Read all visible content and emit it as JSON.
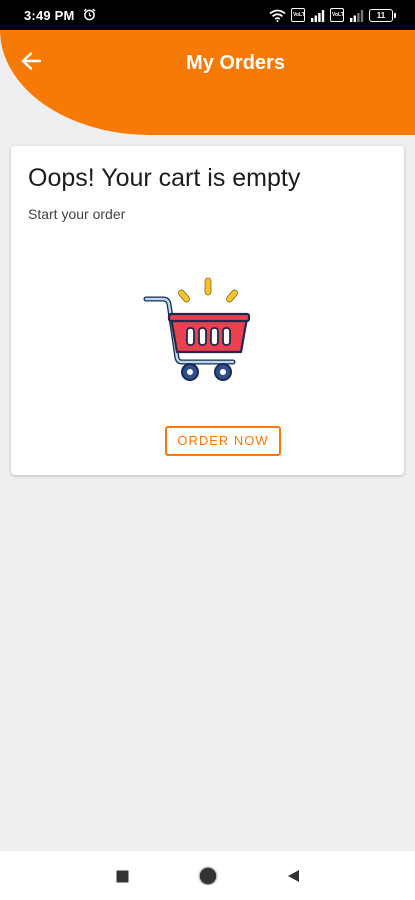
{
  "status_bar": {
    "time": "3:49 PM",
    "alarm_icon": "alarm-icon",
    "wifi_icon": "wifi-icon",
    "sim1_label": "VoLTE",
    "sim2_label": "VoLTE",
    "battery_level": "11"
  },
  "header": {
    "title": "My Orders",
    "back_icon": "arrow-left-icon",
    "background_color": "#f77a06"
  },
  "empty_state": {
    "title": "Oops! Your cart is empty",
    "subtitle": "Start your order",
    "illustration": "shopping-cart-icon",
    "button_label": "ORDER NOW"
  },
  "nav_bar": {
    "recent_icon": "square-icon",
    "home_icon": "circle-icon",
    "back_icon": "triangle-back-icon"
  }
}
